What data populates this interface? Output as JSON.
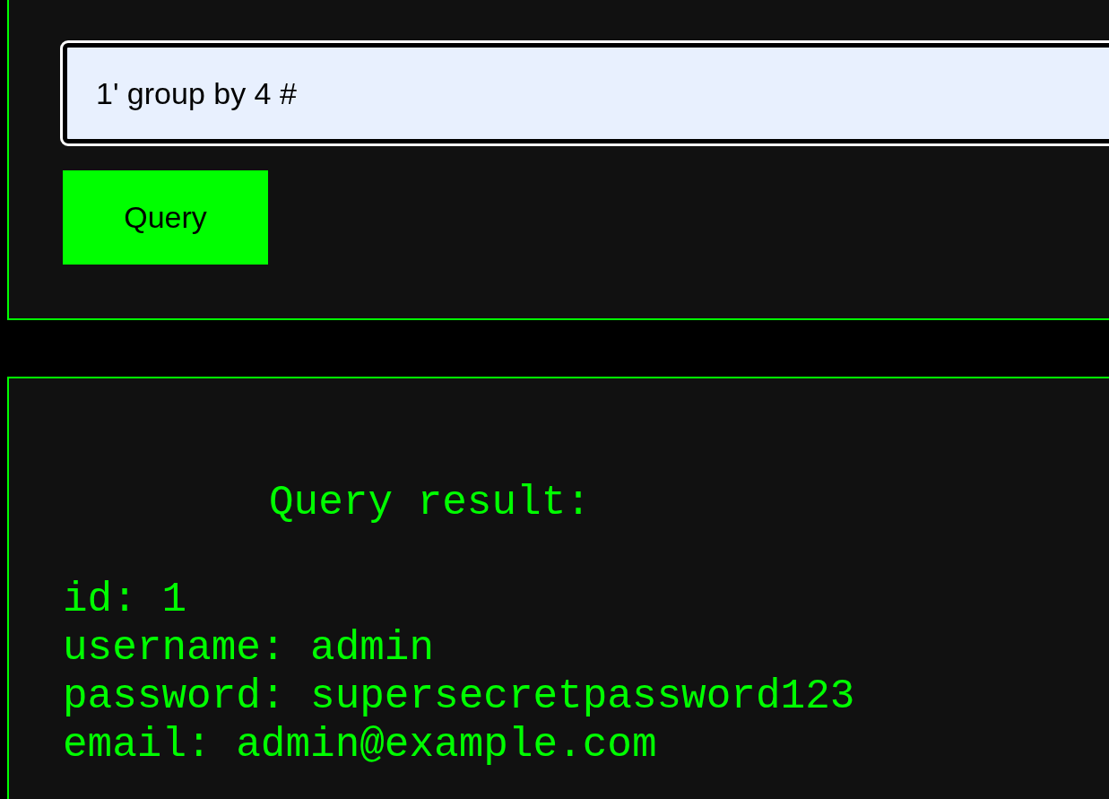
{
  "query_field": {
    "value": "1' group by 4 #"
  },
  "query_button": {
    "label": "Query"
  },
  "result": {
    "heading": "Query result:",
    "lines": [
      "id: 1",
      "username: admin",
      "password: supersecretpassword123",
      "email: admin@example.com"
    ]
  }
}
